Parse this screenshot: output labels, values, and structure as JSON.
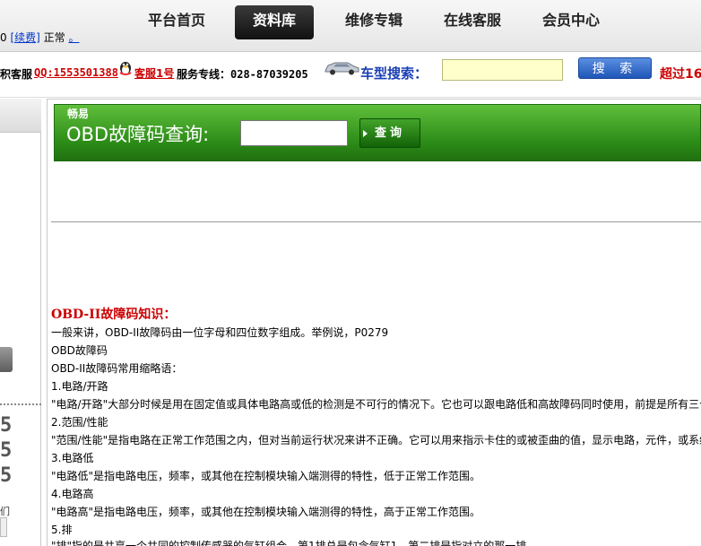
{
  "nav": {
    "items": [
      "平台首页",
      "资料库",
      "维修专辑",
      "在线客服",
      "会员中心"
    ],
    "active_index": 1
  },
  "status": {
    "prefix": "0",
    "renew_link": "[续费]",
    "state": "正常",
    "dot_link": "。"
  },
  "service": {
    "left_text": "积客服",
    "qq_link": "QQ:1553501388",
    "kefu_link": "客服1号",
    "hotline": "服务专线：028-87039205",
    "model_search_label": "车型搜索：",
    "search_value": "",
    "search_button": "搜 索",
    "over_text": "超过16"
  },
  "sidebar": {
    "digits": [
      "5",
      "5",
      "5"
    ],
    "small_text": "们"
  },
  "obd": {
    "brand": "畅易",
    "title": "OBD故障码查询:",
    "input_value": "",
    "query_button": "查询"
  },
  "knowledge": {
    "title": "OBD-II故障码知识：",
    "lines": [
      "一般来讲，OBD-II故障码由一位字母和四位数字组成。举例说，P0279",
      "OBD故障码",
      "OBD-II故障码常用缩略语：",
      "1.电路/开路",
      "\"电路/开路\"大部分时候是用在固定值或具体电路高或低的检测是不可行的情况下。它也可以跟电路低和高故障码同时使用，前提是所有三个",
      "2.范围/性能",
      "\"范围/性能\"是指电路在正常工作范围之内，但对当前运行状况来讲不正确。它可以用来指示卡住的或被歪曲的值，显示电路，元件，或系统的性",
      "3.电路低",
      "\"电路低\"是指电路电压，频率，或其他在控制模块输入端测得的特性，低于正常工作范围。",
      "4.电路高",
      "\"电路高\"是指电路电压，频率，或其他在控制模块输入端测得的特性，高于正常工作范围。",
      "5.排",
      "\"排\"指的是共享一个共同的控制传感器的气缸组合，第1排总是包含气缸1，第二排是指对立的那一排。"
    ]
  },
  "colors": {
    "accent_red": "#cc0000",
    "banner_green": "#2b8a17",
    "link_blue": "#0033cc",
    "model_blue": "#1a3fb5"
  }
}
